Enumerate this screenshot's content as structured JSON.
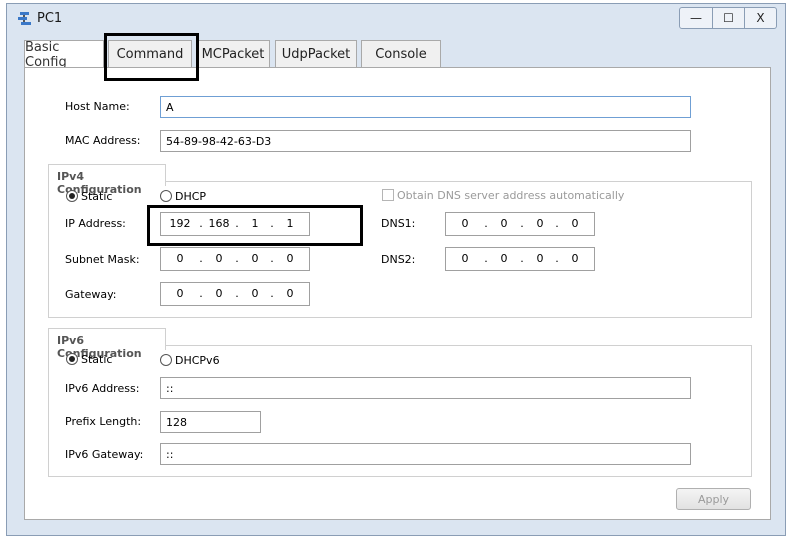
{
  "window": {
    "title": "PC1",
    "icon": "network-pc-icon",
    "controls": {
      "minimize": "—",
      "maximize": "☐",
      "close": "X"
    }
  },
  "tabs": [
    {
      "label": "Basic Config",
      "active": true
    },
    {
      "label": "Command",
      "active": false
    },
    {
      "label": "MCPacket",
      "active": false
    },
    {
      "label": "UdpPacket",
      "active": false
    },
    {
      "label": "Console",
      "active": false
    }
  ],
  "basic": {
    "host_name_label": "Host Name:",
    "host_name_value": "A",
    "mac_label": "MAC Address:",
    "mac_value": "54-89-98-42-63-D3"
  },
  "ipv4": {
    "title": "IPv4 Configuration",
    "static_label": "Static",
    "dhcp_label": "DHCP",
    "obtain_dns_label": "Obtain DNS server address automatically",
    "ip_label": "IP Address:",
    "ip": [
      "192",
      "168",
      "1",
      "1"
    ],
    "mask_label": "Subnet Mask:",
    "mask": [
      "0",
      "0",
      "0",
      "0"
    ],
    "gateway_label": "Gateway:",
    "gateway": [
      "0",
      "0",
      "0",
      "0"
    ],
    "dns1_label": "DNS1:",
    "dns1": [
      "0",
      "0",
      "0",
      "0"
    ],
    "dns2_label": "DNS2:",
    "dns2": [
      "0",
      "0",
      "0",
      "0"
    ]
  },
  "ipv6": {
    "title": "IPv6 Configuration",
    "static_label": "Static",
    "dhcp_label": "DHCPv6",
    "address_label": "IPv6 Address:",
    "address_value": "::",
    "prefix_label": "Prefix Length:",
    "prefix_value": "128",
    "gateway_label": "IPv6 Gateway:",
    "gateway_value": "::"
  },
  "apply_label": "Apply"
}
